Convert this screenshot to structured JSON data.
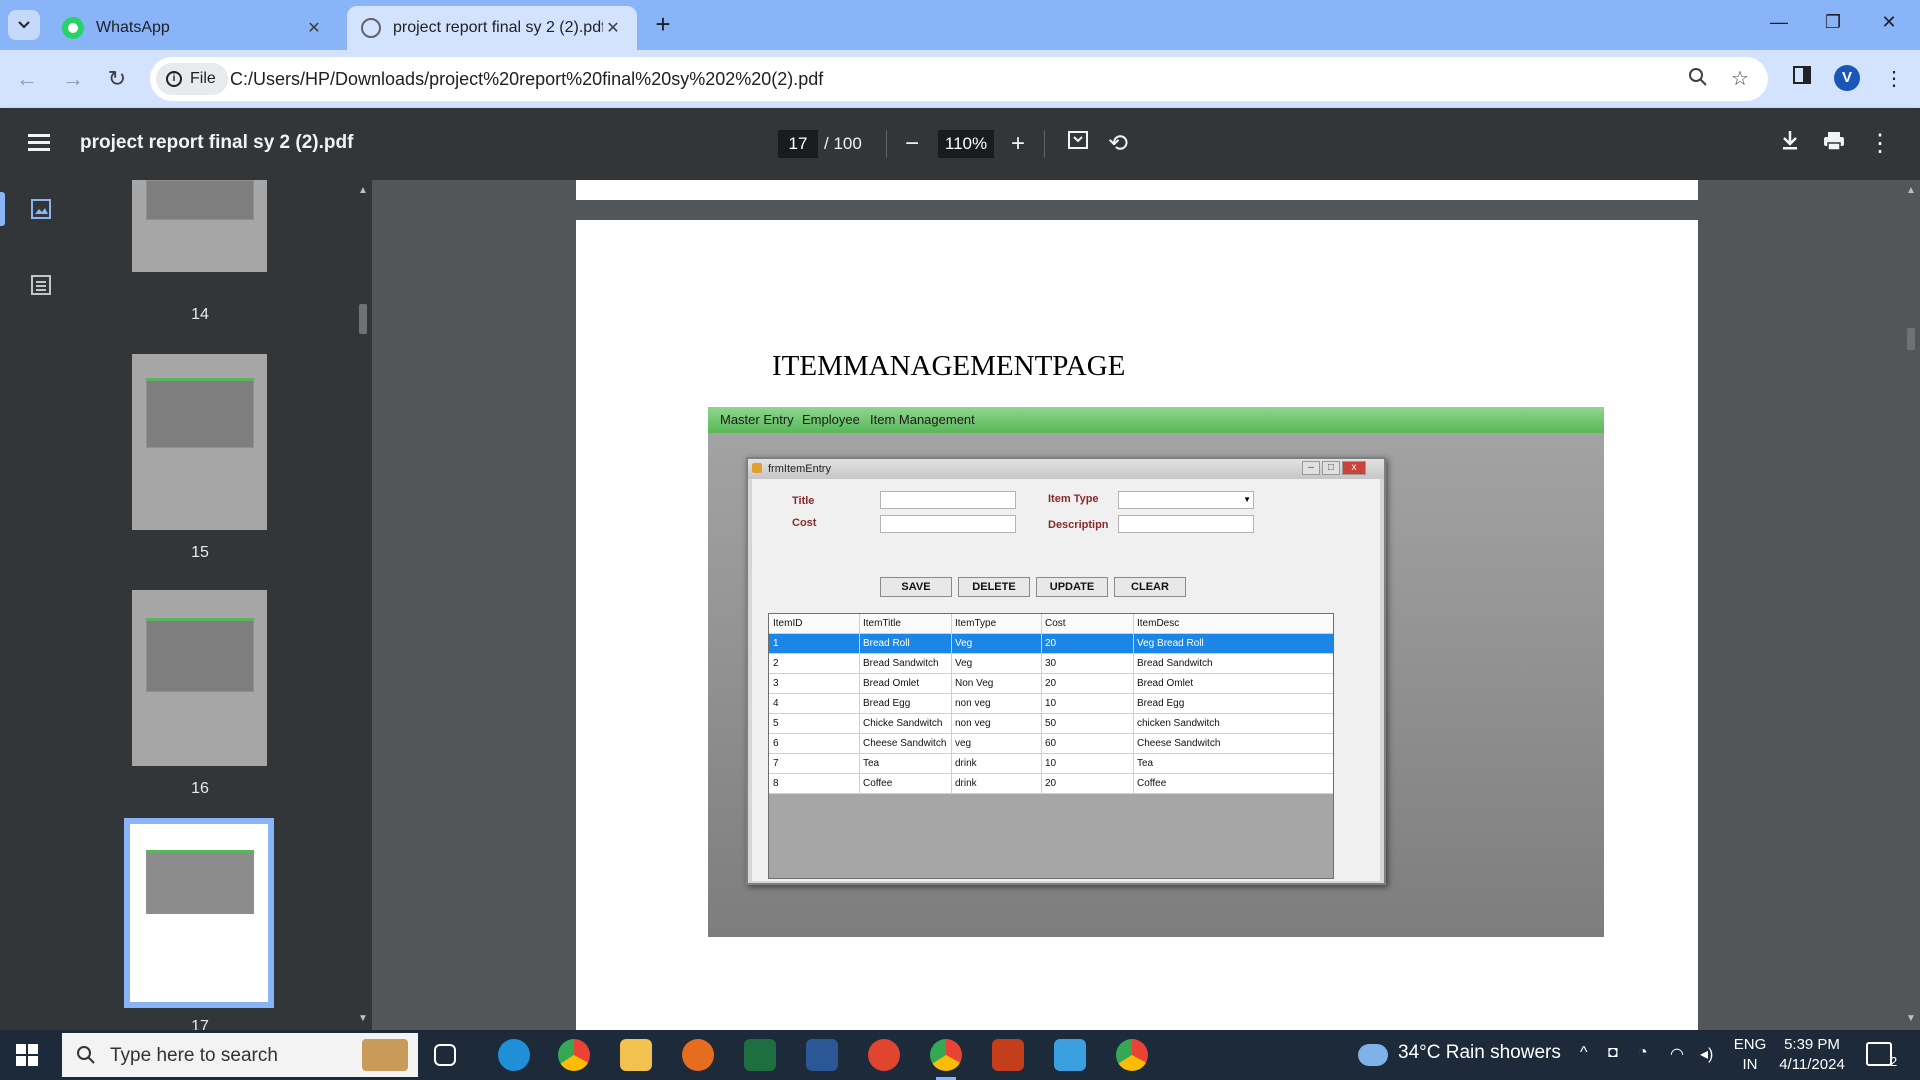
{
  "browser": {
    "tabs": [
      {
        "title": "WhatsApp",
        "active": false
      },
      {
        "title": "project report final sy 2 (2).pdf",
        "active": true
      }
    ],
    "url_chip": "File",
    "url": "C:/Users/HP/Downloads/project%20report%20final%20sy%202%20(2).pdf",
    "profile_initial": "V"
  },
  "pdf_toolbar": {
    "title": "project report final sy 2 (2).pdf",
    "current_page": "17",
    "total_pages": "/ 100",
    "zoom": "110%"
  },
  "sidebar": {
    "thumbnails": [
      {
        "label": "14"
      },
      {
        "label": "15"
      },
      {
        "label": "16"
      },
      {
        "label": "17"
      }
    ]
  },
  "page": {
    "heading": "ITEMMANAGEMENTPAGE",
    "screenshot": {
      "menu": [
        "Master Entry",
        "Employee",
        "Item Management"
      ],
      "window_title": "frmItemEntry",
      "labels": {
        "title": "Title",
        "cost": "Cost",
        "item_type": "Item Type",
        "description": "Descriptipn"
      },
      "buttons": [
        "SAVE",
        "DELETE",
        "UPDATE",
        "CLEAR"
      ],
      "grid": {
        "columns": [
          "ItemID",
          "ItemTitle",
          "ItemType",
          "Cost",
          "ItemDesc"
        ],
        "rows": [
          [
            "1",
            "Bread Roll",
            "Veg",
            "20",
            "Veg Bread Roll"
          ],
          [
            "2",
            "Bread Sandwitch",
            "Veg",
            "30",
            "Bread Sandwitch"
          ],
          [
            "3",
            "Bread Omlet",
            "Non Veg",
            "20",
            "Bread Omlet"
          ],
          [
            "4",
            "Bread  Egg",
            "non veg",
            "10",
            "Bread Egg"
          ],
          [
            "5",
            "Chicke Sandwitch",
            "non veg",
            "50",
            "chicken Sandwitch"
          ],
          [
            "6",
            "Cheese Sandwitch",
            "veg",
            "60",
            "Cheese Sandwitch"
          ],
          [
            "7",
            "Tea",
            "drink",
            "10",
            "Tea"
          ],
          [
            "8",
            "Coffee",
            "drink",
            "20",
            "Coffee"
          ]
        ]
      }
    }
  },
  "taskbar": {
    "search_placeholder": "Type here to search",
    "weather": "34°C  Rain showers",
    "lang_line1": "ENG",
    "lang_line2": "IN",
    "time": "5:39 PM",
    "date": "4/11/2024",
    "notification_count": "2"
  },
  "colors": {
    "tabbar": "#8ab4f8",
    "pdf_toolbar": "#323639",
    "viewer_bg": "#525659",
    "selected_row": "#1c86e6",
    "menubar_green": "#58b858"
  }
}
